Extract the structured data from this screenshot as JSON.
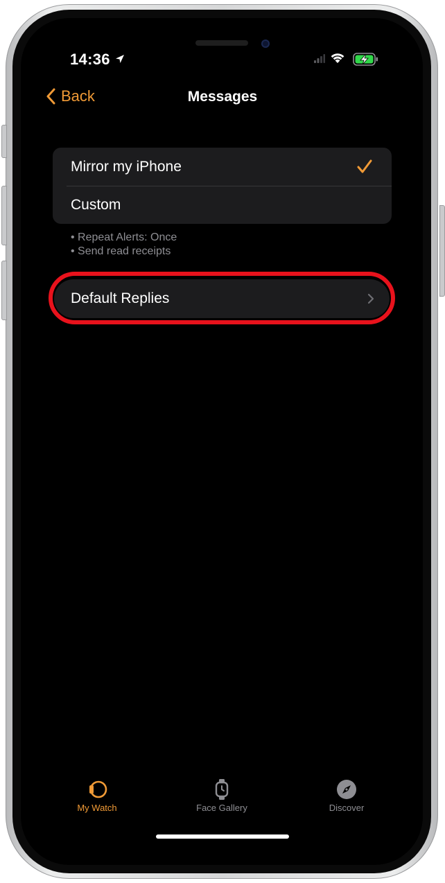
{
  "status_bar": {
    "time": "14:36",
    "icons": [
      "location-arrow-icon",
      "signal-icon",
      "wifi-icon",
      "battery-charging-icon"
    ]
  },
  "nav": {
    "back_label": "Back",
    "title": "Messages"
  },
  "alert_options": {
    "items": [
      {
        "label": "Mirror my iPhone",
        "selected": true
      },
      {
        "label": "Custom",
        "selected": false
      }
    ],
    "footnote": [
      "• Repeat Alerts: Once",
      "• Send read receipts"
    ]
  },
  "default_replies": {
    "label": "Default Replies",
    "highlight_color": "#e8121c"
  },
  "tab_bar": {
    "tabs": [
      {
        "label": "My Watch",
        "icon": "watch-icon",
        "active": true
      },
      {
        "label": "Face Gallery",
        "icon": "watch-face-icon",
        "active": false
      },
      {
        "label": "Discover",
        "icon": "compass-icon",
        "active": false
      }
    ]
  },
  "colors": {
    "accent": "#f09a36",
    "background": "#000000",
    "cell": "#1c1c1e",
    "secondary_text": "#8e8e93",
    "inactive_tab": "#8e8e93"
  }
}
